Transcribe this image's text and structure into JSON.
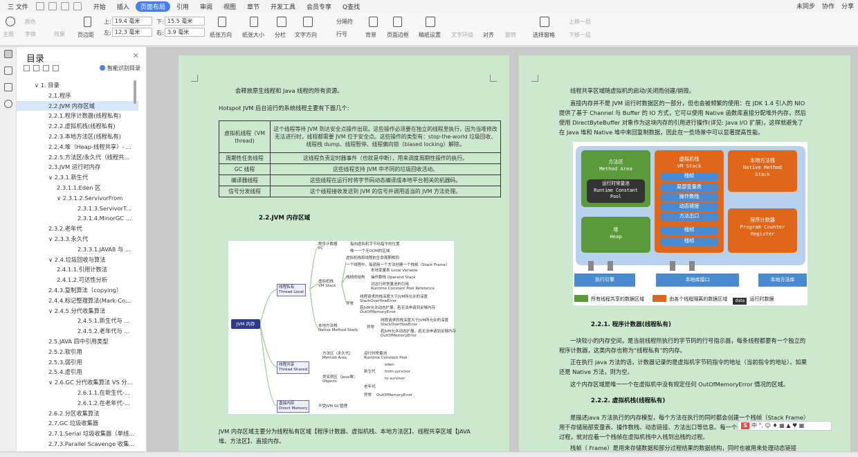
{
  "menubar": {
    "file": "三 文件",
    "tabs": [
      "开始",
      "插入",
      "页面布局",
      "引用",
      "审阅",
      "视图",
      "章节",
      "开发工具",
      "会员专享",
      "Q查找"
    ],
    "active": "页面布局",
    "right": [
      "未同步",
      "协作",
      "分享"
    ]
  },
  "toolbar": {
    "theme": "主题",
    "color": "颜色",
    "font": "字体",
    "effect": "效果",
    "margin": "页边距",
    "top_label": "上:",
    "top_val": "19.4 毫米",
    "bottom_label": "下:",
    "bottom_val": "15.5 毫米",
    "left_label": "左:",
    "left_val": "12.3 毫米",
    "right_label": "右:",
    "right_val": "3.9 毫米",
    "orientation": "纸张方向",
    "size": "纸张大小",
    "columns": "分栏",
    "direction": "文字方向",
    "break": "分隔符",
    "lineno": "行号",
    "bg": "背景",
    "border": "页面边框",
    "manuscript": "稿纸设置",
    "wrap": "文字环绕",
    "align": "对齐",
    "rotate": "旋转",
    "pane": "选择窗格",
    "up": "上移一层",
    "down": "下移一层"
  },
  "toc": {
    "title": "目录",
    "smart": "智能识别目录",
    "items": [
      {
        "t": "∨ 1. 目录",
        "lvl": 0
      },
      {
        "t": "2.1.程序",
        "lvl": 1
      },
      {
        "t": "2.2.JVM 内存区域",
        "lvl": 1,
        "sel": true
      },
      {
        "t": "2.2.1.程序计数器(线程私有)",
        "lvl": 1
      },
      {
        "t": "2.2.2.虚拟机栈(线程私有)",
        "lvl": 1
      },
      {
        "t": "2.2.3.本地方法区(线程私有)",
        "lvl": 1
      },
      {
        "t": "2.2.4.堆（Heap-线程共享）- ...",
        "lvl": 1
      },
      {
        "t": "2.2.5.方法区/永久代（线程共...",
        "lvl": 1
      },
      {
        "t": "2.3.JVM 运行时内存",
        "lvl": 1
      },
      {
        "t": "∨ 2.3.1.新生代",
        "lvl": 1
      },
      {
        "t": "2.3.1.1.Eden 区",
        "lvl": 2
      },
      {
        "t": "∨ 2.3.1.2.ServivorFrom",
        "lvl": 2
      },
      {
        "t": "2.3.1.3.ServivorT...",
        "lvl": 3
      },
      {
        "t": "2.3.1.4.MinorGC ...",
        "lvl": 3
      },
      {
        "t": "2.3.2.老年代",
        "lvl": 1
      },
      {
        "t": "∨ 2.3.3.永久代",
        "lvl": 1
      },
      {
        "t": "2.3.3.1.JAVA8 与 ...",
        "lvl": 3
      },
      {
        "t": "∨ 2.4.垃圾回收与算法",
        "lvl": 1
      },
      {
        "t": "2.4.1.1.引用计数法",
        "lvl": 2
      },
      {
        "t": "2.4.1.2.可达性分析",
        "lvl": 2
      },
      {
        "t": "2.4.3.复制算法（copying）",
        "lvl": 1
      },
      {
        "t": "2.4.4.标记整理算法(Mark-Co...",
        "lvl": 1
      },
      {
        "t": "∨ 2.4.5.分代收集算法",
        "lvl": 1
      },
      {
        "t": "2.4.5.1.新生代与 ...",
        "lvl": 3
      },
      {
        "t": "2.4.5.2.老年代与 ...",
        "lvl": 3
      },
      {
        "t": "2.5.JAVA 四中引用类型",
        "lvl": 1
      },
      {
        "t": "2.5.2.软引用",
        "lvl": 1
      },
      {
        "t": "2.5.3.弱引用",
        "lvl": 1
      },
      {
        "t": "2.5.4.虚引用",
        "lvl": 1
      },
      {
        "t": "∨ 2.6.GC 分代收集算法 VS 分区 ...",
        "lvl": 1
      },
      {
        "t": "2.6.1.1.在新生代-...",
        "lvl": 3
      },
      {
        "t": "2.6.1.2.在老年代-...",
        "lvl": 3
      },
      {
        "t": "2.6.2.分区收集算法",
        "lvl": 1
      },
      {
        "t": "2.7.GC 垃圾收集器",
        "lvl": 1
      },
      {
        "t": "2.7.1.Serial 垃圾收集器（单线...",
        "lvl": 1
      },
      {
        "t": "2.7.3.Parallel Scavenge 收集...",
        "lvl": 1
      }
    ]
  },
  "page1": {
    "line1": "会释放原生线程和 Java 线程的所有资源。",
    "intro": "Hotspot JVM 后台运行的系统线程主要有下面几个:",
    "table": [
      [
        "虚拟机线程（VM thread)",
        "这个线程等待 JVM 到达安全点操作出现。这些操作必须要在独立的线程里执行，因为当堆修改无法进行时，线程都需要 JVM 位于安全点。这些操作的类型有：stop-the-world 垃圾回收、线程栈 dump、线程暂停、线程偏向锁（biased locking）解除。"
      ],
      [
        "周期性任务线程",
        "这线程负责定时器事件（也就是中断），用来调度周期性操作的执行。"
      ],
      [
        "GC 线程",
        "这些线程支持 JVM 中不同的垃圾回收活动。"
      ],
      [
        "编译器线程",
        "这些线程在运行时将字节码动态编译成本地平台相关的机器码。"
      ],
      [
        "信号分发线程",
        "这个线程接收发送到 JVM 的信号并调用适当的 JVM 方法处理。"
      ]
    ],
    "h2": "2.2.JVM 内存区域",
    "mm": {
      "root": "JVM 内存",
      "tl": "线程私有\nThread Local",
      "ts": "线程共享\nThread Shared",
      "dm": "直接内存\nDirect Memory",
      "pc": "程序计数器\nPC",
      "pc1": "指向虚拟机字节码指令的位置",
      "pc2": "唯一一个无OOM的区域",
      "vms": "虚拟机栈\nVM Stack",
      "vms1": "虚拟机栈和线程的生命周期相同",
      "vms2": "一个线程中，每调用一个方法创建一个栈帧（Stack Frame）",
      "frame": "栈帧的结构",
      "f1": "本地变量表 Local Variable",
      "f2": "操作数栈 Operand Stack",
      "f3": "对运行时常量池的引用\nRuntime Constant Pool Reference",
      "ex": "异常",
      "ex1": "线程请求的栈深度大于JVM所允许的深度\nStackOverflowError",
      "ex2": "若JVM允许动态扩展，若无法申请到足够内存\nOutOfMemoryError",
      "nms": "本地方法栈\nNative Method Stack",
      "nex": "异常",
      "ma": "方法区（永久代）\nMethod Area",
      "rcp": "运行时常量池\nRuntime Constant Pool",
      "heap": "类实例区（Java堆）\nObjects",
      "young": "新生代",
      "eden": "eden",
      "from": "from survivor",
      "to": "to survivor",
      "old": "老年代",
      "oom": "OutOfMemoryError",
      "dm1": "不受JVM GC管理"
    },
    "bottom": "JVM 内存区域主要分为线程私有区域【程序计数器、虚拟机栈、本地方法区】、线程共享区域【JAVA 堆、方法区】、直接内存。"
  },
  "page2": {
    "line1": "线程共享区域随虚拟机的启动/关闭而创建/销毁。",
    "para1": "直接内存并不是 JVM 运行时数据区的一部分，但也会被频繁的使用：在 JDK 1.4 引入的 NIO 提供了基于 Channel 与 Buffer 的 IO 方式，它可以使用 Native 函数库直接分配堆外内存，然后使用 DirectByteBuffer 对象作为这块内存的引用进行操作(详见: Java I/O 扩展)，这样就避免了在 Java 堆和 Native 堆中来回复制数据，因此在一些场景中可以显著提高性能。",
    "jvm": {
      "ma": "方法区\nMethod Area",
      "rcp": "运行时常量池\nRuntime Constant\nPool",
      "vms": "虚拟机栈\nVM Stack",
      "frame": "栈帧",
      "lv": "局部变量表",
      "os": "操作数栈",
      "dl": "动态链接",
      "me": "方法出口",
      "frame2": "栈帧",
      "frame3": "栈帧",
      "nms": "本地方法栈\nNative Method\nStack",
      "heap": "堆\nHeap",
      "pc": "程序计数器\nProgram Counter\nRegister",
      "engine": "执行引擎",
      "native_if": "本地库接口",
      "native_lib": "本地方法库",
      "lg1": "所有线程共享的数据区域",
      "lg2": "由各个线程隔离的数据区域",
      "lg3": "运行时数据",
      "lg3b": "data"
    },
    "h3a": "2.2.1.   程序计数器(线程私有)",
    "p2": "一块较小的内存空间，是当前线程所执行的字节码的行号指示器，每条线程都要有一个独立的程序计数器，这类内存也称为“线程私有”的内存。",
    "p3": "正在执行 java 方法的话，计数器记录的是虚拟机字节码指令的地址（当前指令的地址）。如果还是 Native 方法，则为空。",
    "p4": "这个内存区域是唯一一个在虚拟机中没有规定任何 OutOfMemoryError 情况的区域。",
    "h3b": "2.2.2.   虚拟机栈(线程私有)",
    "p5": "是描述java 方法执行的内存模型，每个方法在执行的同时都会创建一个栈帧（Stack Frame）用于存储局部变量表、操作数栈、动态链接、方法出口等信息。每一个方法从调用直至执行完成的过程，就对应着一个栈帧在虚拟机栈中入栈到出栈的过程。",
    "p6": "栈帧（ Frame）是用来存储数据和部分过程结果的数据结构，同时也被用来处理动态链接"
  },
  "ime": {
    "text": "中 °, ☺ ♦ ▦ ▲ ♥ ▦"
  }
}
